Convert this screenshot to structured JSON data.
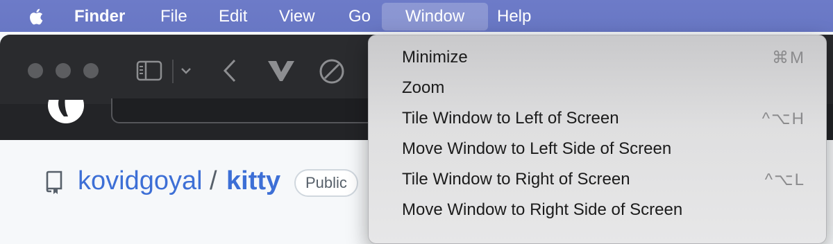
{
  "menubar": {
    "apple_icon": "apple-logo-icon",
    "items": [
      {
        "label": "Finder",
        "bold": true
      },
      {
        "label": "File"
      },
      {
        "label": "Edit"
      },
      {
        "label": "View"
      },
      {
        "label": "Go"
      },
      {
        "label": "Window",
        "active": true
      },
      {
        "label": "Help"
      }
    ]
  },
  "browser": {
    "toolbar_icons": [
      "sidebar-toggle-icon",
      "chevron-down-icon",
      "back-arrow-icon",
      "vivaldi-logo-icon",
      "block-icon"
    ],
    "repo": {
      "owner": "kovidgoyal",
      "separator": "/",
      "name": "kitty",
      "visibility": "Public"
    }
  },
  "window_menu": {
    "items": [
      {
        "label": "Minimize",
        "shortcut": "⌘M"
      },
      {
        "label": "Zoom",
        "shortcut": ""
      },
      {
        "label": "Tile Window to Left of Screen",
        "shortcut": "^⌥H"
      },
      {
        "label": "Move Window to Left Side of Screen",
        "shortcut": ""
      },
      {
        "label": "Tile Window to Right of Screen",
        "shortcut": "^⌥L"
      },
      {
        "label": "Move Window to Right Side of Screen",
        "shortcut": ""
      }
    ]
  },
  "colors": {
    "menubar": "#6d7bc8",
    "link": "#3d6fd6",
    "toolbar": "#2a2b2e"
  }
}
